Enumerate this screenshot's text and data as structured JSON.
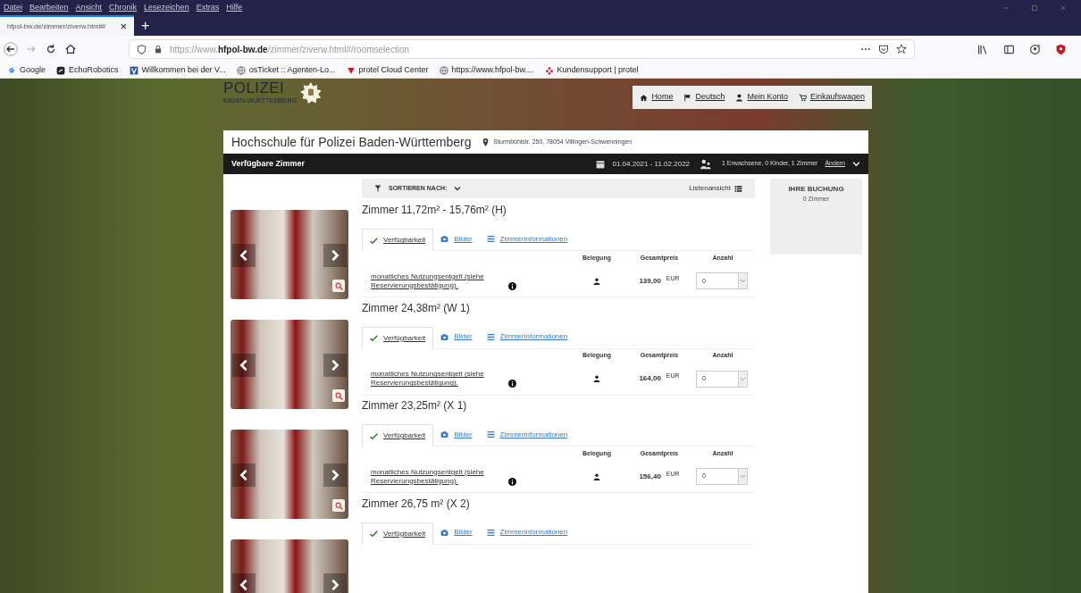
{
  "browser": {
    "menu": [
      "Datei",
      "Bearbeiten",
      "Ansicht",
      "Chronik",
      "Lesezeichen",
      "Extras",
      "Hilfe"
    ],
    "tab": {
      "title": "hfpol-bw.de/zimmer/ziverw.html#/",
      "close": "×"
    },
    "new_tab": "+",
    "url": {
      "scheme": "https://www.",
      "domain": "hfpol-bw.de",
      "path": "/zimmer/ziverw.html#/roomselection"
    },
    "bookmarks": [
      {
        "label": "Google",
        "kind": "google"
      },
      {
        "label": "EchoRobotics",
        "kind": "square"
      },
      {
        "label": "Willkommen bei der V...",
        "kind": "v"
      },
      {
        "label": "osTicket :: Agenten-Lo...",
        "kind": "globe"
      },
      {
        "label": "protel Cloud Center",
        "kind": "protel"
      },
      {
        "label": "https://www.hfpol-bw....",
        "kind": "globe"
      },
      {
        "label": "Kundensupport | protel",
        "kind": "flower"
      }
    ]
  },
  "site": {
    "logo": {
      "name": "POLIZEI",
      "sub": "BADEN-WÜRTTEMBERG"
    },
    "nav": [
      "Home",
      "Deutsch",
      "Mein Konto",
      "Einkaufswagen"
    ],
    "hotel": {
      "name": "Hochschule für Polizei Baden-Württemberg",
      "address": "Sturmbühlstr. 250, 78054 Villingen-Schwenningen"
    },
    "bar": {
      "title": "Verfügbare Zimmer",
      "dates": "01.04.2021 - 11.02.2022",
      "guests": "1 Erwachsene, 0 Kinder, 1 Zimmer",
      "change": "Ändern"
    },
    "sort": {
      "label": "SORTIEREN NACH:",
      "view": "Listenansicht"
    },
    "booking": {
      "title": "IHRE BUCHUNG",
      "count": "0 Zimmer"
    },
    "rooms": [
      {
        "title": "Zimmer 11,72m² - 15,76m² (H)",
        "tabs": [
          {
            "label": "Verfügbarkeit",
            "selected": true
          },
          {
            "label": "Bilder",
            "selected": false
          },
          {
            "label": "Zimmerinformationen",
            "selected": false
          }
        ],
        "columns": [
          "Belegung",
          "Gesamtpreis",
          "Anzahl"
        ],
        "rate": {
          "name": "monatliches Nutzungsentgelt (siehe Reservierungsbestätigung).",
          "price": "139,00",
          "currency": "EUR",
          "quantity": "0"
        }
      },
      {
        "title": "Zimmer 24,38m² (W 1)",
        "tabs": [
          {
            "label": "Verfügbarkeit",
            "selected": true
          },
          {
            "label": "Bilder",
            "selected": false
          },
          {
            "label": "Zimmerinformationen",
            "selected": false
          }
        ],
        "columns": [
          "Belegung",
          "Gesamtpreis",
          "Anzahl"
        ],
        "rate": {
          "name": "monatliches Nutzungsentgelt (siehe Reservierungsbestätigung).",
          "price": "164,00",
          "currency": "EUR",
          "quantity": "0"
        }
      },
      {
        "title": "Zimmer 23,25m² (X 1)",
        "tabs": [
          {
            "label": "Verfügbarkeit",
            "selected": true
          },
          {
            "label": "Bilder",
            "selected": false
          },
          {
            "label": "Zimmerinformationen",
            "selected": false
          }
        ],
        "columns": [
          "Belegung",
          "Gesamtpreis",
          "Anzahl"
        ],
        "rate": {
          "name": "monatliches Nutzungsentgelt (siehe Reservierungsbestätigung).",
          "price": "156,40",
          "currency": "EUR",
          "quantity": "0"
        }
      },
      {
        "title": "Zimmer 26,75 m² (X 2)",
        "tabs": [
          {
            "label": "Verfügbarkeit",
            "selected": true
          },
          {
            "label": "Bilder",
            "selected": false
          },
          {
            "label": "Zimmerinformationen",
            "selected": false
          }
        ]
      }
    ]
  }
}
